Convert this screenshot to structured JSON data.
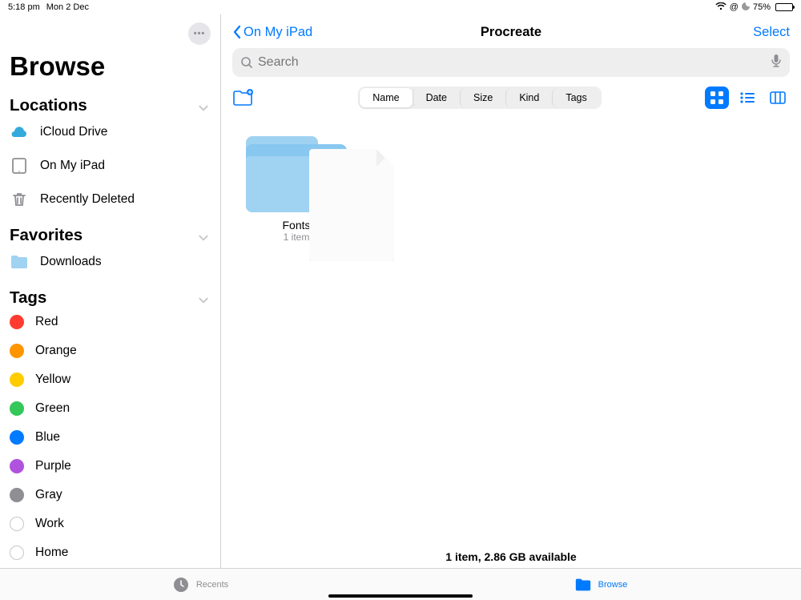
{
  "status": {
    "time": "5:18 pm",
    "date": "Mon 2 Dec",
    "battery_pct": "75%"
  },
  "sidebar": {
    "title": "Browse",
    "sections": {
      "locations": {
        "heading": "Locations",
        "items": [
          "iCloud Drive",
          "On My iPad",
          "Recently Deleted"
        ]
      },
      "favorites": {
        "heading": "Favorites",
        "items": [
          "Downloads"
        ]
      },
      "tags": {
        "heading": "Tags",
        "items": [
          {
            "label": "Red",
            "color": "#ff3b30"
          },
          {
            "label": "Orange",
            "color": "#ff9500"
          },
          {
            "label": "Yellow",
            "color": "#ffcc00"
          },
          {
            "label": "Green",
            "color": "#34c759"
          },
          {
            "label": "Blue",
            "color": "#007aff"
          },
          {
            "label": "Purple",
            "color": "#af52de"
          },
          {
            "label": "Gray",
            "color": "#8e8e93"
          },
          {
            "label": "Work",
            "color": null
          },
          {
            "label": "Home",
            "color": null
          }
        ]
      }
    }
  },
  "content": {
    "back_label": "On My iPad",
    "title": "Procreate",
    "select_label": "Select",
    "search_placeholder": "Search",
    "sort_options": [
      "Name",
      "Date",
      "Size",
      "Kind",
      "Tags"
    ],
    "sort_selected": "Name",
    "items": [
      {
        "name": "Fonts",
        "subtitle": "1 item"
      }
    ],
    "footer": "1 item, 2.86 GB available"
  },
  "tabs": {
    "recents": "Recents",
    "browse": "Browse"
  }
}
